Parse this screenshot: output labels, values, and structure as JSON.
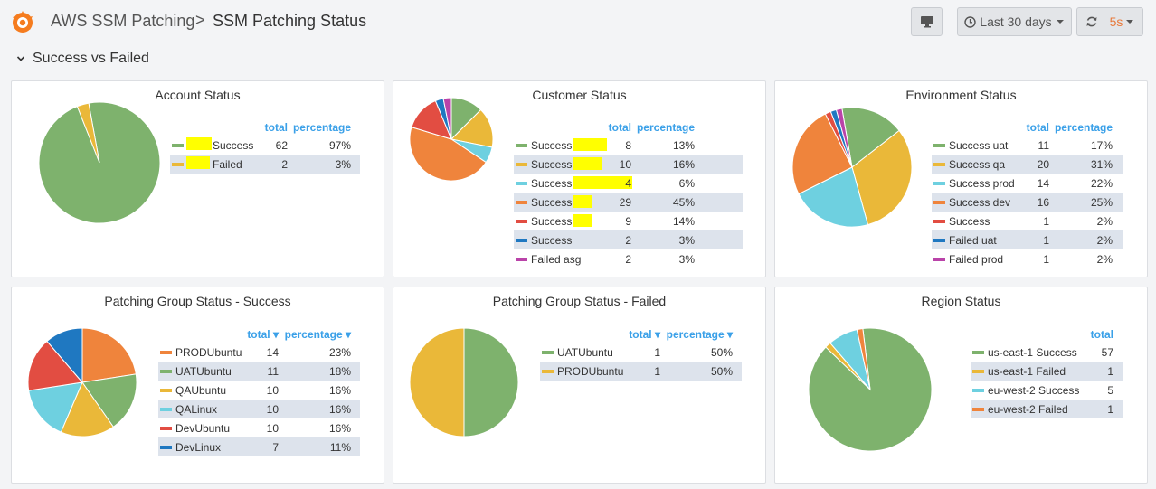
{
  "breadcrumb": {
    "folder": "AWS SSM Patching",
    "separator": ">",
    "dashboard": "SSM Patching Status"
  },
  "toolbar": {
    "time_range": "Last 30 days",
    "refresh_interval": "5s"
  },
  "row": {
    "title": "Success vs Failed",
    "chevron": "⌄"
  },
  "icons": {
    "logo": "grafana-logo-icon",
    "tv": "monitor-icon",
    "clock": "clock-icon",
    "refresh": "refresh-icon",
    "caret": "caret-down-icon"
  },
  "colors": {
    "green": "#7eb26d",
    "yellow": "#eab839",
    "cyan": "#6ed0e0",
    "orange": "#ef843c",
    "red": "#e24d42",
    "blue": "#1f78c1",
    "purple": "#ba43a9",
    "link": "#3aa0e8"
  },
  "panels": [
    {
      "title": "Account Status",
      "headers": {
        "total": "total",
        "percentage": "percentage"
      },
      "items": [
        {
          "name": "Success",
          "total": "62",
          "percentage": "97%",
          "color": "#7eb26d",
          "redacted": true
        },
        {
          "name": "Failed",
          "total": "2",
          "percentage": "3%",
          "color": "#eab839",
          "redacted": true
        }
      ]
    },
    {
      "title": "Customer Status",
      "headers": {
        "total": "total",
        "percentage": "percentage"
      },
      "items": [
        {
          "name": "Success",
          "total": "8",
          "percentage": "13%",
          "color": "#7eb26d",
          "redacted": true
        },
        {
          "name": "Success",
          "total": "10",
          "percentage": "16%",
          "color": "#eab839",
          "redacted": true
        },
        {
          "name": "Success",
          "total": "4",
          "percentage": "6%",
          "color": "#6ed0e0",
          "redacted": true
        },
        {
          "name": "Success",
          "total": "29",
          "percentage": "45%",
          "color": "#ef843c",
          "redacted": true
        },
        {
          "name": "Success",
          "total": "9",
          "percentage": "14%",
          "color": "#e24d42",
          "redacted": true
        },
        {
          "name": "Success",
          "total": "2",
          "percentage": "3%",
          "color": "#1f78c1"
        },
        {
          "name": "Failed asg",
          "total": "2",
          "percentage": "3%",
          "color": "#ba43a9"
        }
      ]
    },
    {
      "title": "Environment Status",
      "headers": {
        "total": "total",
        "percentage": "percentage"
      },
      "items": [
        {
          "name": "Success uat",
          "total": "11",
          "percentage": "17%",
          "color": "#7eb26d"
        },
        {
          "name": "Success qa",
          "total": "20",
          "percentage": "31%",
          "color": "#eab839"
        },
        {
          "name": "Success prod",
          "total": "14",
          "percentage": "22%",
          "color": "#6ed0e0"
        },
        {
          "name": "Success dev",
          "total": "16",
          "percentage": "25%",
          "color": "#ef843c"
        },
        {
          "name": "Success",
          "total": "1",
          "percentage": "2%",
          "color": "#e24d42"
        },
        {
          "name": "Failed uat",
          "total": "1",
          "percentage": "2%",
          "color": "#1f78c1"
        },
        {
          "name": "Failed prod",
          "total": "1",
          "percentage": "2%",
          "color": "#ba43a9"
        }
      ]
    },
    {
      "title": "Patching Group Status - Success",
      "headers": {
        "total": "total",
        "percentage": "percentage",
        "sort_arrow": "▾"
      },
      "items": [
        {
          "name": "PRODUbuntu",
          "total": "14",
          "percentage": "23%",
          "color": "#ef843c"
        },
        {
          "name": "UATUbuntu",
          "total": "11",
          "percentage": "18%",
          "color": "#7eb26d"
        },
        {
          "name": "QAUbuntu",
          "total": "10",
          "percentage": "16%",
          "color": "#eab839"
        },
        {
          "name": "QALinux",
          "total": "10",
          "percentage": "16%",
          "color": "#6ed0e0"
        },
        {
          "name": "DevUbuntu",
          "total": "10",
          "percentage": "16%",
          "color": "#e24d42"
        },
        {
          "name": "DevLinux",
          "total": "7",
          "percentage": "11%",
          "color": "#1f78c1"
        }
      ]
    },
    {
      "title": "Patching Group Status - Failed",
      "headers": {
        "total": "total",
        "percentage": "percentage",
        "sort_arrow": "▾"
      },
      "items": [
        {
          "name": "UATUbuntu",
          "total": "1",
          "percentage": "50%",
          "color": "#7eb26d"
        },
        {
          "name": "PRODUbuntu",
          "total": "1",
          "percentage": "50%",
          "color": "#eab839"
        }
      ]
    },
    {
      "title": "Region Status",
      "headers": {
        "total": "total"
      },
      "items": [
        {
          "name": "us-east-1 Success",
          "total": "57",
          "color": "#7eb26d"
        },
        {
          "name": "us-east-1 Failed",
          "total": "1",
          "color": "#eab839"
        },
        {
          "name": "eu-west-2 Success",
          "total": "5",
          "color": "#6ed0e0"
        },
        {
          "name": "eu-west-2 Failed",
          "total": "1",
          "color": "#ef843c"
        }
      ]
    }
  ]
}
